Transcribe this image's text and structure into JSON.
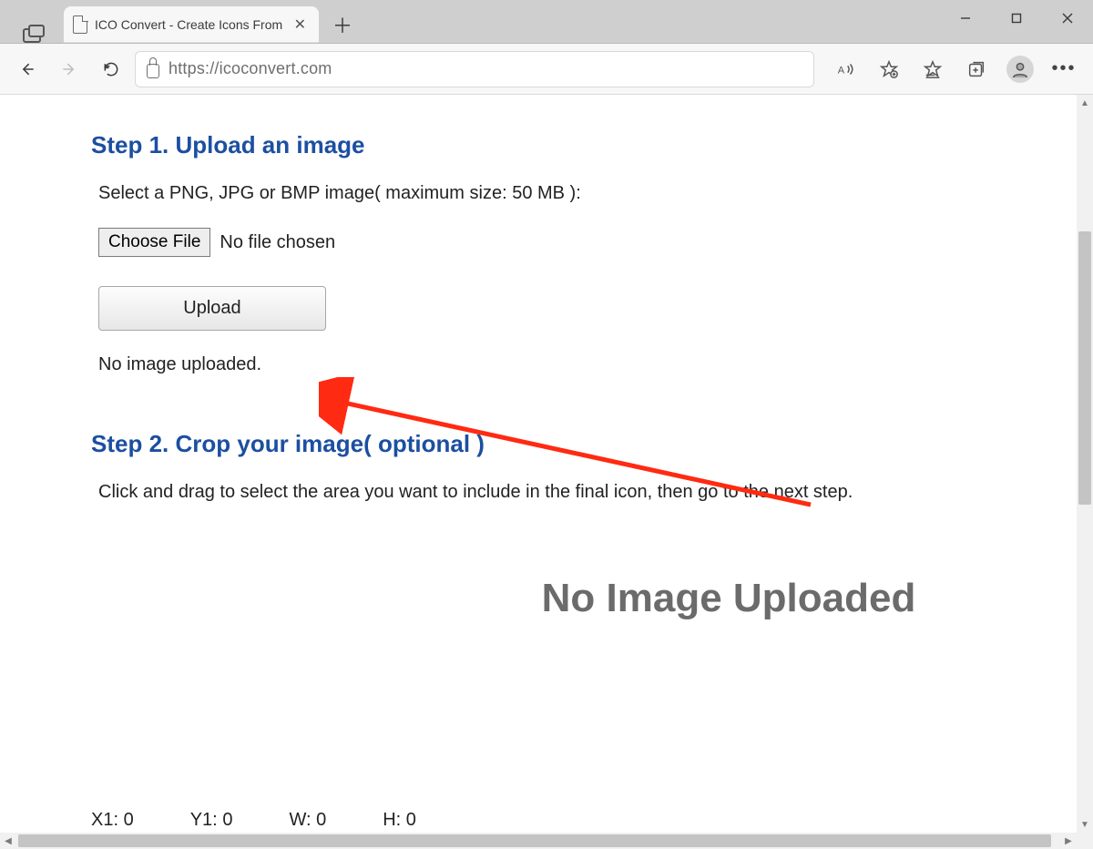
{
  "browser": {
    "tab_title": "ICO Convert - Create Icons From",
    "url": "https://icoconvert.com"
  },
  "page": {
    "step1": {
      "heading": "Step 1. Upload an image",
      "description": "Select a PNG, JPG or BMP image( maximum size: 50 MB ):",
      "choose_file_label": "Choose File",
      "file_status": "No file chosen",
      "upload_label": "Upload",
      "upload_status": "No image uploaded."
    },
    "step2": {
      "heading": "Step 2. Crop your image( optional )",
      "description": "Click and drag to select the area you want to include in the final icon, then go to the next step.",
      "placeholder": "No Image Uploaded",
      "coords": {
        "x1_label": "X1:",
        "x1": "0",
        "y1_label": "Y1:",
        "y1": "0",
        "w_label": "W:",
        "w": "0",
        "h_label": "H:",
        "h": "0"
      }
    }
  }
}
